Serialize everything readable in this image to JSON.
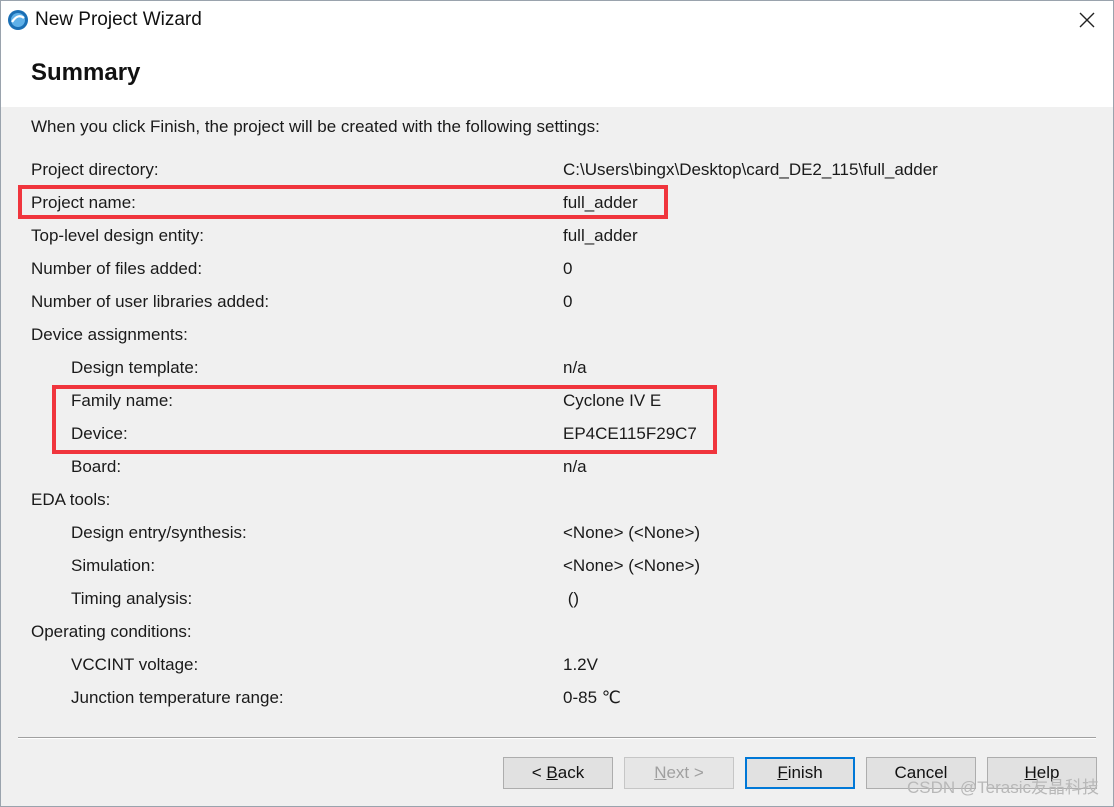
{
  "window": {
    "title": "New Project Wizard"
  },
  "page": {
    "heading": "Summary",
    "intro": "When you click Finish, the project will be created with the following settings:"
  },
  "rows": {
    "project_directory": {
      "label": "Project directory:",
      "value": "C:\\Users\\bingx\\Desktop\\card_DE2_115\\full_adder"
    },
    "project_name": {
      "label": "Project name:",
      "value": "full_adder"
    },
    "top_level": {
      "label": "Top-level design entity:",
      "value": "full_adder"
    },
    "files_added": {
      "label": "Number of files added:",
      "value": "0"
    },
    "user_libraries": {
      "label": "Number of user libraries added:",
      "value": "0"
    },
    "device_assignments": {
      "label": "Device assignments:"
    },
    "design_template": {
      "label": "Design template:",
      "value": "n/a"
    },
    "family_name": {
      "label": "Family name:",
      "value": "Cyclone IV E"
    },
    "device": {
      "label": "Device:",
      "value": "EP4CE115F29C7"
    },
    "board": {
      "label": "Board:",
      "value": "n/a"
    },
    "eda_tools": {
      "label": "EDA tools:"
    },
    "design_entry": {
      "label": "Design entry/synthesis:",
      "value": "<None> (<None>)"
    },
    "simulation": {
      "label": "Simulation:",
      "value": "<None> (<None>)"
    },
    "timing_analysis": {
      "label": "Timing analysis:",
      "value": " ()"
    },
    "operating_conditions": {
      "label": "Operating conditions:"
    },
    "vccint": {
      "label": "VCCINT voltage:",
      "value": "1.2V"
    },
    "junction_temp": {
      "label": "Junction temperature range:",
      "value": "0-85 ℃"
    }
  },
  "buttons": {
    "back": {
      "prefix": "< ",
      "mnemonic": "B",
      "rest": "ack"
    },
    "next": {
      "mnemonic": "N",
      "rest": "ext >"
    },
    "finish": {
      "mnemonic": "F",
      "rest": "inish"
    },
    "cancel": "Cancel",
    "help": {
      "mnemonic": "H",
      "rest": "elp"
    }
  },
  "watermark": "CSDN @Terasic友晶科技",
  "colors": {
    "highlight": "#f0353d",
    "default_button_border": "#0078d7",
    "dialog_bg": "#f0f0f0"
  }
}
